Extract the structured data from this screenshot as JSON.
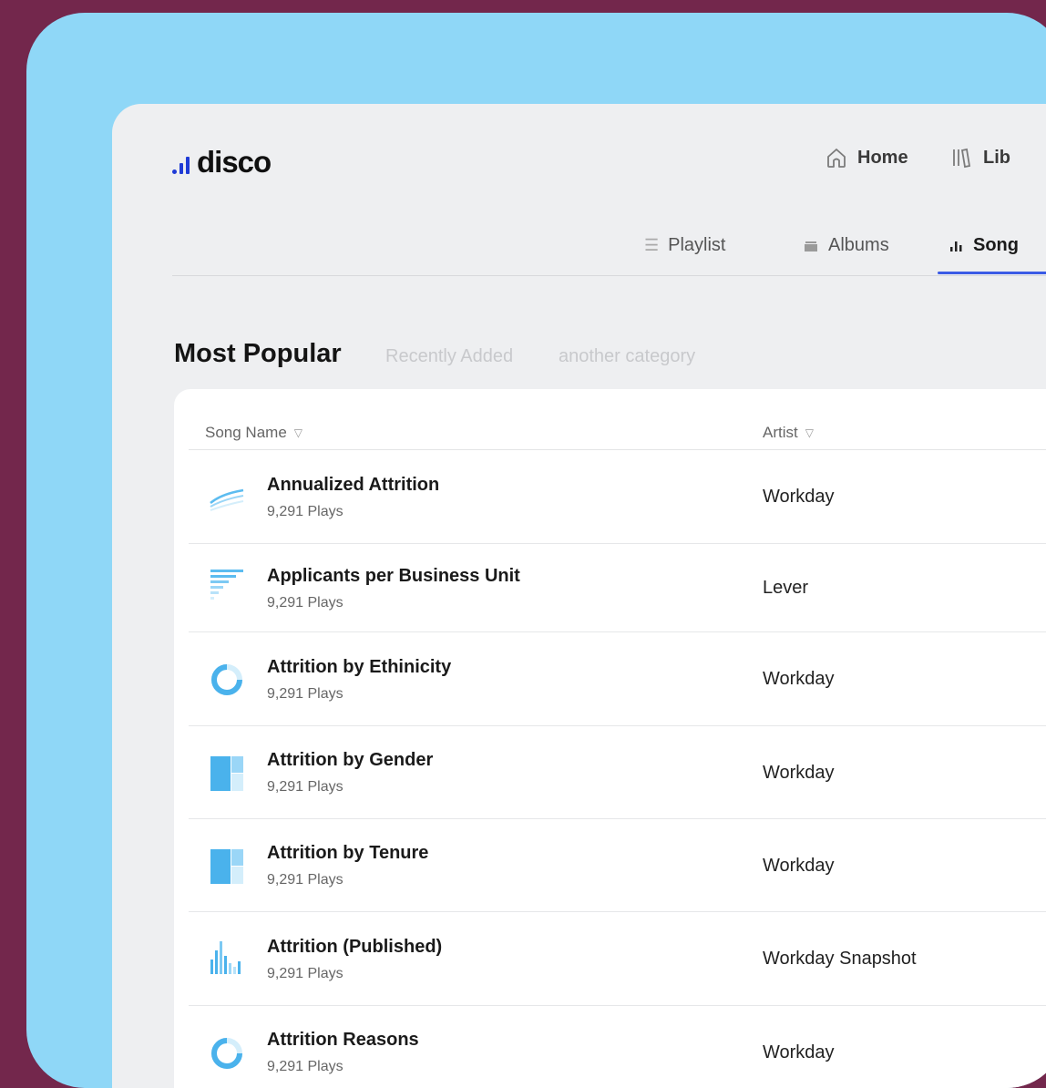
{
  "brand": {
    "name": "disco",
    "accent": "#1f3bd6"
  },
  "top_nav": [
    {
      "label": "Home",
      "icon": "home-icon"
    },
    {
      "label": "Lib",
      "icon": "library-icon"
    }
  ],
  "sub_nav": [
    {
      "label": "Playlist",
      "icon": "list-icon"
    },
    {
      "label": "Albums",
      "icon": "albums-icon"
    },
    {
      "label": "Song",
      "icon": "songs-icon",
      "active": true
    }
  ],
  "section": {
    "title": "Most Popular",
    "categories": [
      "Recently Added",
      "another category"
    ]
  },
  "table": {
    "columns": [
      "Song Name",
      "Artist"
    ],
    "rows": [
      {
        "title": "Annualized Attrition",
        "plays": "9,291 Plays",
        "artist": "Workday",
        "icon": "line-chart-icon"
      },
      {
        "title": "Applicants per Business Unit",
        "plays": "9,291 Plays",
        "artist": "Lever",
        "icon": "bar-chart-icon"
      },
      {
        "title": "Attrition by Ethinicity",
        "plays": "9,291 Plays",
        "artist": "Workday",
        "icon": "donut-chart-icon"
      },
      {
        "title": "Attrition by Gender",
        "plays": "9,291 Plays",
        "artist": "Workday",
        "icon": "treemap-icon"
      },
      {
        "title": "Attrition by Tenure",
        "plays": "9,291 Plays",
        "artist": "Workday",
        "icon": "treemap-icon"
      },
      {
        "title": "Attrition (Published)",
        "plays": "9,291 Plays",
        "artist": "Workday Snapshot",
        "icon": "column-chart-icon"
      },
      {
        "title": "Attrition Reasons",
        "plays": "9,291 Plays",
        "artist": "Workday",
        "icon": "donut-chart-icon"
      }
    ]
  }
}
